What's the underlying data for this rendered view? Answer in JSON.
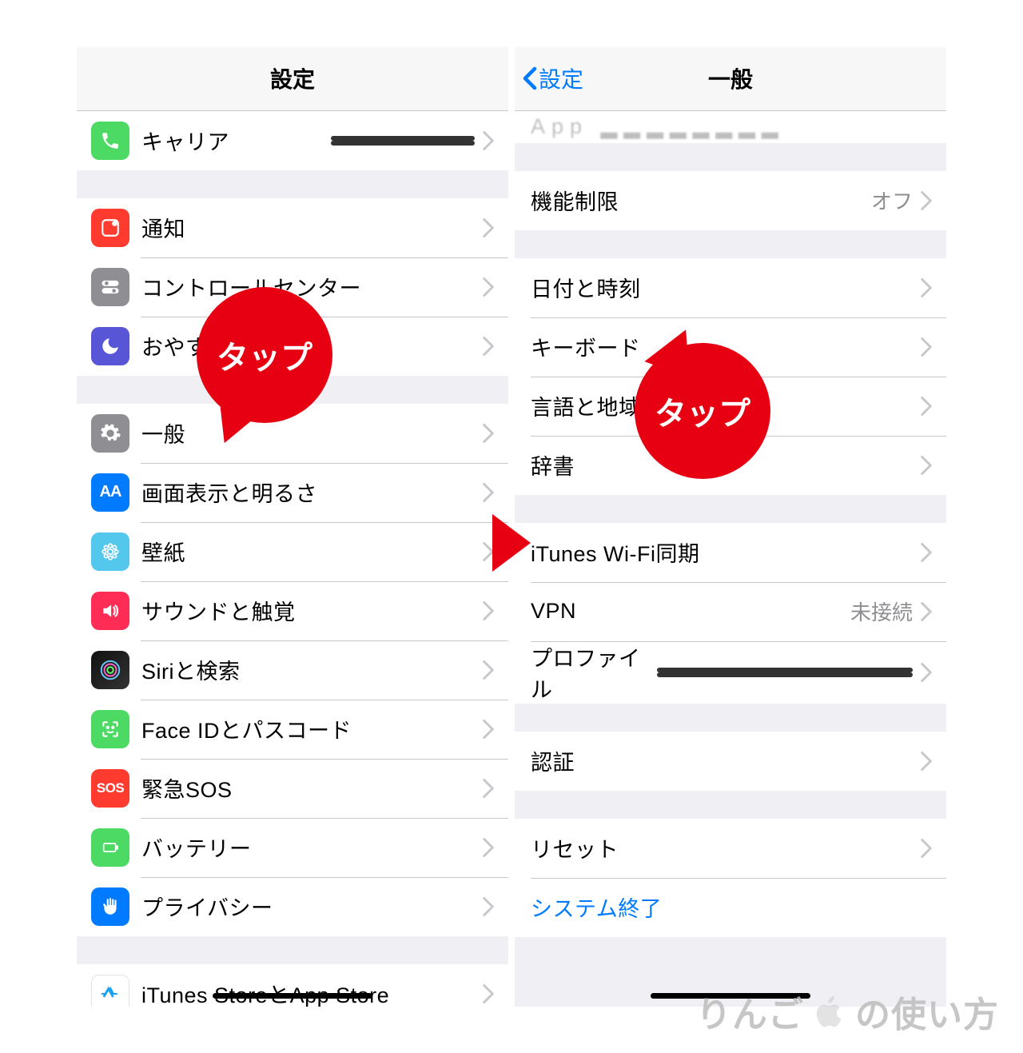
{
  "callout_label": "タップ",
  "watermark": {
    "text_left": "りんご",
    "text_right": "の使い方"
  },
  "left": {
    "title": "設定",
    "rows": {
      "carrier": {
        "label": "キャリア"
      },
      "notif": {
        "label": "通知"
      },
      "control": {
        "label": "コントロールセンター"
      },
      "dnd": {
        "label": "おやすみ"
      },
      "general": {
        "label": "一般"
      },
      "display": {
        "label": "画面表示と明るさ"
      },
      "wallpaper": {
        "label": "壁紙"
      },
      "sound": {
        "label": "サウンドと触覚"
      },
      "siri": {
        "label": "Siriと検索"
      },
      "faceid": {
        "label": "Face IDとパスコード"
      },
      "sos": {
        "label": "緊急SOS"
      },
      "battery": {
        "label": "バッテリー"
      },
      "privacy": {
        "label": "プライバシー"
      },
      "store": {
        "label": "iTunes StoreとApp Store"
      }
    }
  },
  "right": {
    "title": "一般",
    "back_label": "設定",
    "rows": {
      "restrict": {
        "label": "機能制限",
        "detail": "オフ"
      },
      "datetime": {
        "label": "日付と時刻"
      },
      "keyboard": {
        "label": "キーボード"
      },
      "lang": {
        "label": "言語と地域"
      },
      "dict": {
        "label": "辞書"
      },
      "ituneswifi": {
        "label": "iTunes Wi-Fi同期"
      },
      "vpn": {
        "label": "VPN",
        "detail": "未接続"
      },
      "profile": {
        "label": "プロファイル"
      },
      "cert": {
        "label": "認証"
      },
      "reset": {
        "label": "リセット"
      },
      "shutdown": {
        "label": "システム終了"
      }
    }
  }
}
